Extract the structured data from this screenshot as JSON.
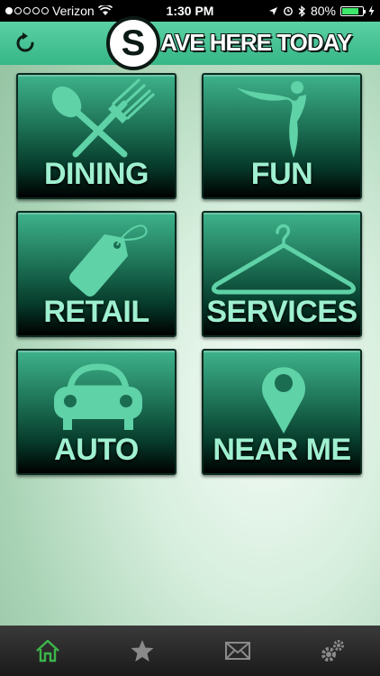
{
  "status_bar": {
    "carrier": "Verizon",
    "time": "1:30 PM",
    "battery": "80%",
    "battery_level": 0.8
  },
  "header": {
    "logo_letter": "S",
    "logo_text": "AVE HERE TODAY"
  },
  "tiles": [
    {
      "label": "DINING",
      "icon": "fork-spoon-icon"
    },
    {
      "label": "FUN",
      "icon": "dancer-icon"
    },
    {
      "label": "RETAIL",
      "icon": "price-tag-icon"
    },
    {
      "label": "SERVICES",
      "icon": "hanger-icon"
    },
    {
      "label": "AUTO",
      "icon": "car-icon"
    },
    {
      "label": "NEAR ME",
      "icon": "map-pin-icon"
    }
  ],
  "tabbar": {
    "items": [
      "home-icon",
      "star-icon",
      "mail-icon",
      "gears-icon"
    ],
    "active_color": "#3bb54a",
    "inactive_color": "#8a8a8a"
  },
  "colors": {
    "header": "#4ac597",
    "tile_label": "#9ff0d0",
    "icon_fill": "#5fd2a7"
  }
}
